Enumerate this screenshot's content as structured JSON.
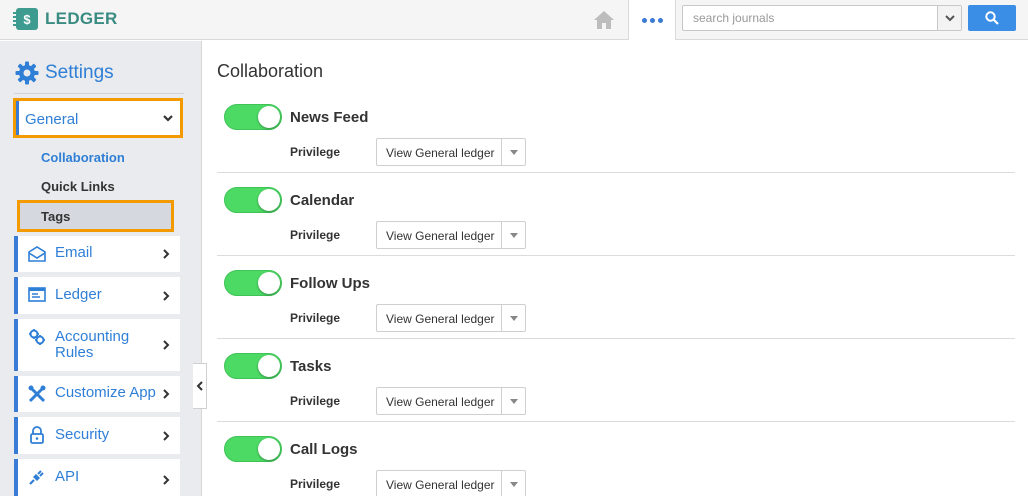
{
  "app": {
    "logo_text": "LEDGER",
    "logo_glyph": "$",
    "brand_color": "#3d9b8f",
    "accent_color": "#2f7fd6",
    "highlight_color": "#f39a00"
  },
  "topbar": {
    "home_icon": "home-icon",
    "more_icon": "more-dots-icon",
    "search_placeholder": "search journals",
    "search_value": "",
    "search_icon": "search-icon"
  },
  "sidebar": {
    "title": "Settings",
    "title_icon": "gear-icon",
    "general": {
      "label": "General",
      "expanded": true
    },
    "sub_items": [
      {
        "label": "Collaboration",
        "active": true
      },
      {
        "label": "Quick Links",
        "active": false
      },
      {
        "label": "Tags",
        "active": false,
        "highlighted": true
      }
    ],
    "items": [
      {
        "label": "Email",
        "icon": "envelope-icon"
      },
      {
        "label": "Ledger",
        "icon": "ledger-icon"
      },
      {
        "label": "Accounting Rules",
        "icon": "gears-icon"
      },
      {
        "label": "Customize App",
        "icon": "tools-icon"
      },
      {
        "label": "Security",
        "icon": "lock-icon"
      },
      {
        "label": "API",
        "icon": "plug-icon"
      }
    ]
  },
  "main": {
    "title": "Collaboration",
    "privilege_label": "Privilege",
    "rows": [
      {
        "title": "News Feed",
        "enabled": true,
        "privilege": "View General ledger"
      },
      {
        "title": "Calendar",
        "enabled": true,
        "privilege": "View General ledger"
      },
      {
        "title": "Follow Ups",
        "enabled": true,
        "privilege": "View General ledger"
      },
      {
        "title": "Tasks",
        "enabled": true,
        "privilege": "View General ledger"
      },
      {
        "title": "Call Logs",
        "enabled": true,
        "privilege": "View General ledger"
      }
    ]
  }
}
